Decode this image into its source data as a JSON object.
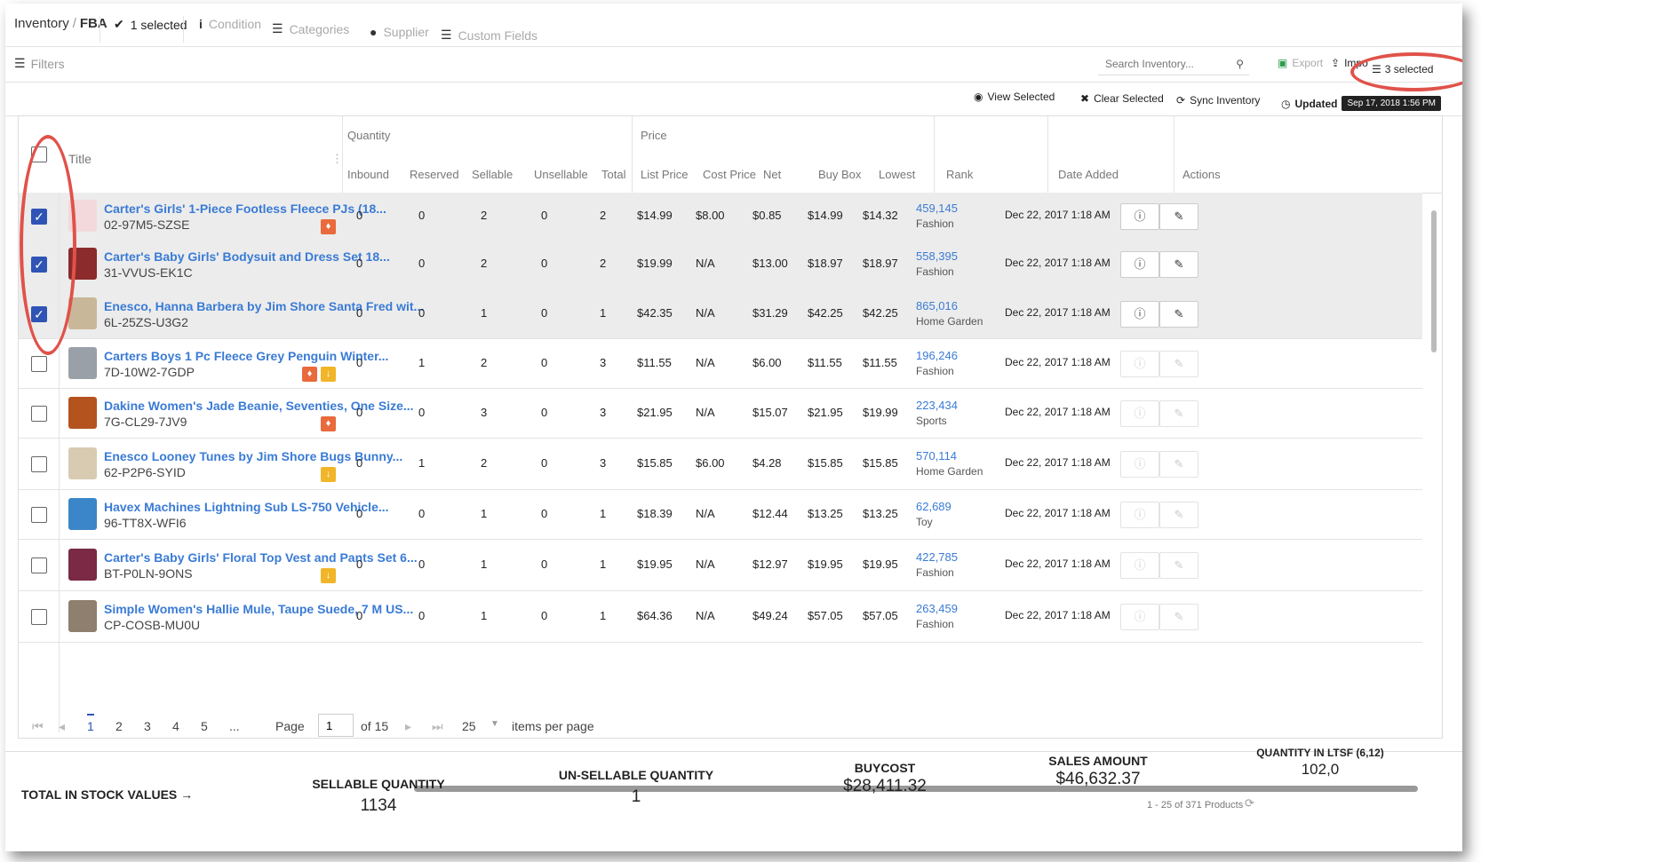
{
  "breadcrumb": {
    "parent": "Inventory",
    "sep": "/",
    "current": "FBA"
  },
  "toolbar": {
    "selected": "1 selected",
    "condition": "Condition",
    "categories": "Categories",
    "supplier": "Supplier",
    "custom_fields": "Custom Fields",
    "filters": "Filters"
  },
  "search": {
    "placeholder": "Search Inventory..."
  },
  "actions": {
    "export": "Export",
    "import": "Impo",
    "selected_count": "3 selected",
    "view_selected": "View Selected",
    "clear_selected": "Clear Selected",
    "sync": "Sync Inventory",
    "updated": "Updated",
    "updated_date": "Sep 17, 2018 1:56 PM"
  },
  "table": {
    "headers": {
      "title": "Title",
      "quantity": "Quantity",
      "inbound": "Inbound",
      "reserved": "Reserved",
      "sellable": "Sellable",
      "unsellable": "Unsellable",
      "total": "Total",
      "price": "Price",
      "list_price": "List Price",
      "cost_price": "Cost Price",
      "net": "Net",
      "buy_box": "Buy Box",
      "lowest": "Lowest",
      "rank": "Rank",
      "date_added": "Date Added",
      "actions": "Actions"
    },
    "rows": [
      {
        "checked": true,
        "title": "Carter's Girls' 1-Piece Footless Fleece PJs (18...",
        "sku": "02-97M5-SZSE",
        "tags": [
          "red"
        ],
        "inbound": "0",
        "reserved": "0",
        "sellable": "2",
        "unsellable": "0",
        "total": "2",
        "list_price": "$14.99",
        "cost_price": "$8.00",
        "net": "$0.85",
        "buy_box": "$14.99",
        "lowest": "$14.32",
        "rank": "459,145",
        "category": "Fashion",
        "date": "Dec 22, 2017 1:18 AM",
        "thumb": "#f3d9dc"
      },
      {
        "checked": true,
        "title": "Carter's Baby Girls' Bodysuit and Dress Set 18...",
        "sku": "31-VVUS-EK1C",
        "tags": [],
        "inbound": "0",
        "reserved": "0",
        "sellable": "2",
        "unsellable": "0",
        "total": "2",
        "list_price": "$19.99",
        "cost_price": "N/A",
        "net": "$13.00",
        "buy_box": "$18.97",
        "lowest": "$18.97",
        "rank": "558,395",
        "category": "Fashion",
        "date": "Dec 22, 2017 1:18 AM",
        "thumb": "#8c2b2b"
      },
      {
        "checked": true,
        "title": "Enesco, Hanna Barbera by Jim Shore Santa Fred wit...",
        "sku": "6L-25ZS-U3G2",
        "tags": [],
        "inbound": "0",
        "reserved": "0",
        "sellable": "1",
        "unsellable": "0",
        "total": "1",
        "list_price": "$42.35",
        "cost_price": "N/A",
        "net": "$31.29",
        "buy_box": "$42.25",
        "lowest": "$42.25",
        "rank": "865,016",
        "category": "Home Garden",
        "date": "Dec 22, 2017 1:18 AM",
        "thumb": "#c9b79a"
      },
      {
        "checked": false,
        "title": "Carters Boys 1 Pc Fleece Grey Penguin Winter...",
        "sku": "7D-10W2-7GDP",
        "tags": [
          "red",
          "yellow"
        ],
        "inbound": "0",
        "reserved": "1",
        "sellable": "2",
        "unsellable": "0",
        "total": "3",
        "list_price": "$11.55",
        "cost_price": "N/A",
        "net": "$6.00",
        "buy_box": "$11.55",
        "lowest": "$11.55",
        "rank": "196,246",
        "category": "Fashion",
        "date": "Dec 22, 2017 1:18 AM",
        "thumb": "#9aa0a8"
      },
      {
        "checked": false,
        "title": "Dakine Women's Jade Beanie, Seventies, One Size...",
        "sku": "7G-CL29-7JV9",
        "tags": [
          "red"
        ],
        "inbound": "0",
        "reserved": "0",
        "sellable": "3",
        "unsellable": "0",
        "total": "3",
        "list_price": "$21.95",
        "cost_price": "N/A",
        "net": "$15.07",
        "buy_box": "$21.95",
        "lowest": "$19.99",
        "rank": "223,434",
        "category": "Sports",
        "date": "Dec 22, 2017 1:18 AM",
        "thumb": "#b5531f"
      },
      {
        "checked": false,
        "title": "Enesco Looney Tunes by Jim Shore Bugs Bunny...",
        "sku": "62-P2P6-SYID",
        "tags": [
          "yellow"
        ],
        "inbound": "0",
        "reserved": "1",
        "sellable": "2",
        "unsellable": "0",
        "total": "3",
        "list_price": "$15.85",
        "cost_price": "$6.00",
        "net": "$4.28",
        "buy_box": "$15.85",
        "lowest": "$15.85",
        "rank": "570,114",
        "category": "Home Garden",
        "date": "Dec 22, 2017 1:18 AM",
        "thumb": "#d8cbb2"
      },
      {
        "checked": false,
        "title": "Havex Machines Lightning Sub LS-750 Vehicle...",
        "sku": "96-TT8X-WFI6",
        "tags": [],
        "inbound": "0",
        "reserved": "0",
        "sellable": "1",
        "unsellable": "0",
        "total": "1",
        "list_price": "$18.39",
        "cost_price": "N/A",
        "net": "$12.44",
        "buy_box": "$13.25",
        "lowest": "$13.25",
        "rank": "62,689",
        "category": "Toy",
        "date": "Dec 22, 2017 1:18 AM",
        "thumb": "#3b86c9"
      },
      {
        "checked": false,
        "title": "Carter's Baby Girls' Floral Top Vest and Pants Set 6...",
        "sku": "BT-P0LN-9ONS",
        "tags": [
          "yellow"
        ],
        "inbound": "0",
        "reserved": "0",
        "sellable": "1",
        "unsellable": "0",
        "total": "1",
        "list_price": "$19.95",
        "cost_price": "N/A",
        "net": "$12.97",
        "buy_box": "$19.95",
        "lowest": "$19.95",
        "rank": "422,785",
        "category": "Fashion",
        "date": "Dec 22, 2017 1:18 AM",
        "thumb": "#7a2a44"
      },
      {
        "checked": false,
        "title": "Simple Women's Hallie Mule, Taupe Suede, 7 M US...",
        "sku": "CP-COSB-MU0U",
        "tags": [],
        "inbound": "0",
        "reserved": "0",
        "sellable": "1",
        "unsellable": "0",
        "total": "1",
        "list_price": "$64.36",
        "cost_price": "N/A",
        "net": "$49.24",
        "buy_box": "$57.05",
        "lowest": "$57.05",
        "rank": "263,459",
        "category": "Fashion",
        "date": "Dec 22, 2017 1:18 AM",
        "thumb": "#8e7f6e"
      }
    ],
    "summary": "1 - 25 of 371 Products"
  },
  "pagination": {
    "pages": [
      "1",
      "2",
      "3",
      "4",
      "5",
      "..."
    ],
    "page_label": "Page",
    "current": "1",
    "of": "of 15",
    "per_page": "25",
    "per_page_label": "items per page"
  },
  "totals": {
    "label": "TOTAL IN STOCK VALUES →",
    "sellable_label": "SELLABLE QUANTITY",
    "sellable_value": "1134",
    "unsellable_label": "UN-SELLABLE QUANTITY",
    "unsellable_value": "1",
    "buycost_label": "BUYCOST",
    "buycost_value": "$28,411.32",
    "sales_label": "SALES AMOUNT",
    "sales_value": "$46,632.37",
    "ltsf_label": "QUANTITY IN LTSF (6,12)",
    "ltsf_value": "102,0"
  },
  "colors": {
    "accent": "#2f54b5",
    "link": "#3a7bd5",
    "annotation": "#e0524a"
  }
}
